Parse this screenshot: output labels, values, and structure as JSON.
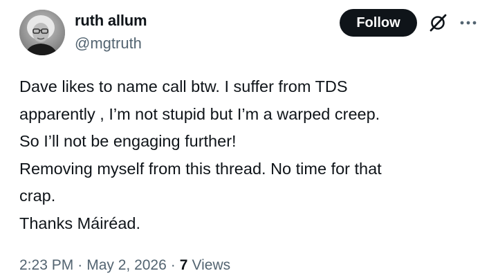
{
  "author": {
    "name": "ruth allum",
    "handle": "@mgtruth"
  },
  "actions": {
    "follow_label": "Follow",
    "grok_icon": "slashed-circle-icon",
    "more_icon": "more-dots-icon"
  },
  "tweet": {
    "lines": [
      "Dave likes to name call btw. I suffer from TDS",
      "apparently , I’m not stupid but I’m a warped creep.",
      "So I’ll not be engaging further!",
      "Removing myself from this thread. No time for that",
      "crap.",
      "Thanks Máiréad."
    ]
  },
  "meta": {
    "time": "2:23 PM",
    "separator": "·",
    "date": "May 2, 2026",
    "views_count": "7",
    "views_label": "Views"
  },
  "colors": {
    "text": "#0f1419",
    "secondary": "#536471",
    "button_bg": "#0f1419",
    "button_text": "#ffffff"
  }
}
